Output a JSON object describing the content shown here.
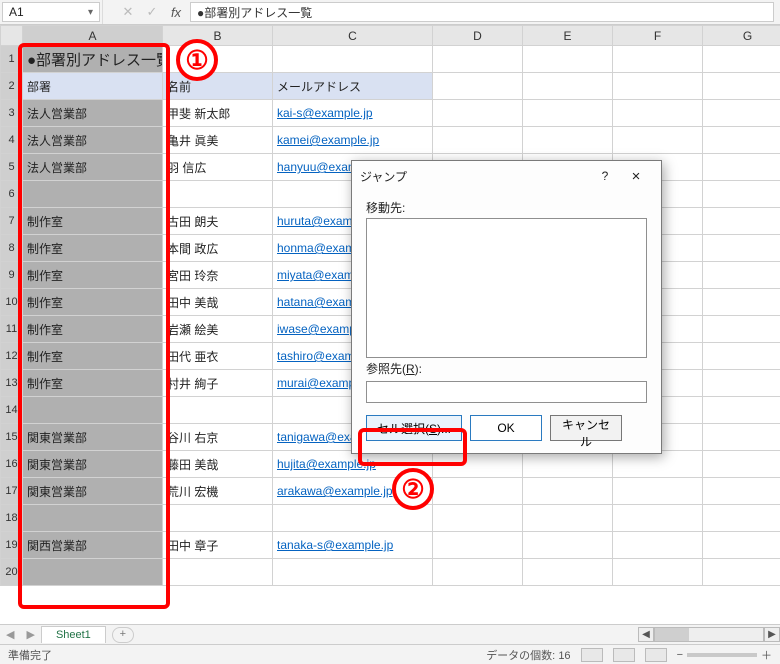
{
  "name_box": "A1",
  "formula_text": "●部署別アドレス一覧",
  "columns": [
    "A",
    "B",
    "C",
    "D",
    "E",
    "F",
    "G"
  ],
  "rows": [
    {
      "n": 1,
      "a": "●部署別アドレス一覧",
      "b": "",
      "c": "",
      "title": true
    },
    {
      "n": 2,
      "a": "部署",
      "b": "名前",
      "c": "メールアドレス",
      "head": true
    },
    {
      "n": 3,
      "a": "法人営業部",
      "b": "甲斐 新太郎",
      "c": "kai-s@example.jp"
    },
    {
      "n": 4,
      "a": "法人営業部",
      "b": "亀井 眞美",
      "c": "kamei@example.jp"
    },
    {
      "n": 5,
      "a": "法人営業部",
      "b": "羽 信広",
      "c": "hanyuu@example.jp"
    },
    {
      "n": 6,
      "a": "",
      "b": "",
      "c": ""
    },
    {
      "n": 7,
      "a": "制作室",
      "b": "古田 朗夫",
      "c": "huruta@example.jp"
    },
    {
      "n": 8,
      "a": "制作室",
      "b": "本間 政広",
      "c": "honma@example.jp"
    },
    {
      "n": 9,
      "a": "制作室",
      "b": "宮田 玲奈",
      "c": "miyata@example.jp"
    },
    {
      "n": 10,
      "a": "制作室",
      "b": "田中 美哉",
      "c": "hatana@example.jp"
    },
    {
      "n": 11,
      "a": "制作室",
      "b": "岩瀬 絵美",
      "c": "iwase@example.jp"
    },
    {
      "n": 12,
      "a": "制作室",
      "b": "田代 亜衣",
      "c": "tashiro@example.jp"
    },
    {
      "n": 13,
      "a": "制作室",
      "b": "村井 絢子",
      "c": "murai@example.jp"
    },
    {
      "n": 14,
      "a": "",
      "b": "",
      "c": ""
    },
    {
      "n": 15,
      "a": "関東営業部",
      "b": "谷川 右京",
      "c": "tanigawa@example.jp"
    },
    {
      "n": 16,
      "a": "関東営業部",
      "b": "藤田 美哉",
      "c": "hujita@example.jp"
    },
    {
      "n": 17,
      "a": "関東営業部",
      "b": "荒川 宏機",
      "c": "arakawa@example.jp"
    },
    {
      "n": 18,
      "a": "",
      "b": "",
      "c": ""
    },
    {
      "n": 19,
      "a": "関西営業部",
      "b": "田中 章子",
      "c": "tanaka-s@example.jp"
    },
    {
      "n": 20,
      "a": "",
      "b": "",
      "c": ""
    }
  ],
  "dialog": {
    "title": "ジャンプ",
    "help": "?",
    "close": "×",
    "move_to_label": "移動先:",
    "ref_label_prefix": "参照先(",
    "ref_label_hot": "R",
    "ref_label_suffix": "):",
    "ref_value": "",
    "select_btn_prefix": "セル選択(",
    "select_btn_hot": "S",
    "select_btn_suffix": ")...",
    "ok": "OK",
    "cancel": "キャンセル"
  },
  "annotations": {
    "one": "①",
    "two": "②"
  },
  "sheet_tab": "Sheet1",
  "status_ready": "準備完了",
  "status_count_label": "データの個数: ",
  "status_count_value": "16",
  "nav_prev": "◀",
  "nav_next": "▶",
  "plus": "+",
  "scroll_left": "◀",
  "scroll_right": "▶",
  "zoom_minus": "−",
  "zoom_plus": "＋"
}
